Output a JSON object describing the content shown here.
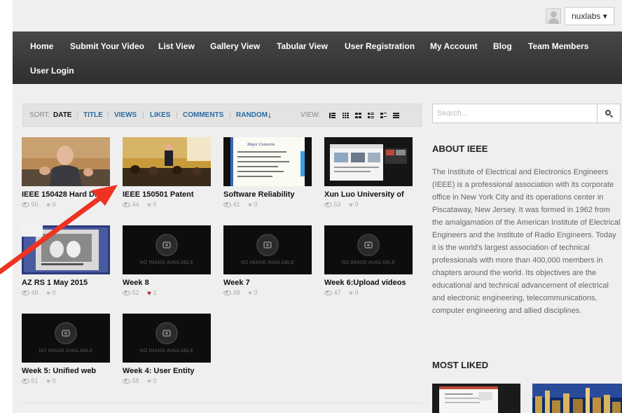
{
  "topbar": {
    "username": "nuxlabs",
    "caret": "▾"
  },
  "nav": [
    {
      "label": "Home"
    },
    {
      "label": "Submit Your Video"
    },
    {
      "label": "List View"
    },
    {
      "label": "Gallery View"
    },
    {
      "label": "Tabular View"
    },
    {
      "label": "User Registration"
    },
    {
      "label": "My Account"
    },
    {
      "label": "Blog"
    },
    {
      "label": "Team Members"
    },
    {
      "label": "User Login"
    }
  ],
  "sortbar": {
    "sort_label": "SORT:",
    "active": "DATE",
    "options": [
      "TITLE",
      "VIEWS",
      "LIKES",
      "COMMENTS"
    ],
    "random": "RANDOM",
    "random_icon": "↓",
    "view_label": "VIEW:",
    "separator": "|"
  },
  "no_image_text": "NO IMAGE AVAILABLE",
  "videos": [
    {
      "title": "IEEE 150428 Hard Drive",
      "views": "50",
      "likes": "0",
      "liked": false
    },
    {
      "title": "IEEE 150501 Patent",
      "views": "44",
      "likes": "0",
      "liked": false
    },
    {
      "title": "Software Reliability",
      "views": "41",
      "likes": "0",
      "liked": false
    },
    {
      "title": "Xun Luo University of",
      "views": "53",
      "likes": "0",
      "liked": false
    },
    {
      "title": "AZ RS 1 May 2015",
      "views": "48",
      "likes": "0",
      "liked": false
    },
    {
      "title": "Week 8",
      "views": "52",
      "likes": "1",
      "liked": true
    },
    {
      "title": "Week 7",
      "views": "48",
      "likes": "0",
      "liked": false
    },
    {
      "title": "Week 6:Upload videos",
      "views": "47",
      "likes": "0",
      "liked": false
    },
    {
      "title": "Week 5: Unified web",
      "views": "51",
      "likes": "0",
      "liked": false
    },
    {
      "title": "Week 4: User Entity",
      "views": "58",
      "likes": "0",
      "liked": false
    }
  ],
  "sidebar": {
    "search_placeholder": "Search...",
    "about_heading": "ABOUT IEEE",
    "about_text": "The Institute of Electrical and Electronics Engineers (IEEE) is a professional association with its corporate office in New York City and its operations center in Piscataway, New Jersey. It was formed in 1962 from the amalgamation of the American Institute of Electrical Engineers and the Institute of Radio Engineers. Today it is the world's largest association of technical professionals with more than 400,000 members in chapters around the world. Its objectives are the educational and technical advancement of electrical and electronic engineering, telecommunications, computer engineering and allied disciplines.",
    "most_liked_heading": "MOST LIKED"
  },
  "colors": {
    "nav_bg": "#3b3b3b",
    "link": "#2a6aa0",
    "annotation_arrow": "#ee3322",
    "liked_heart": "#c0272d"
  },
  "slide_thumb": {
    "heading": "Major Concerns"
  }
}
